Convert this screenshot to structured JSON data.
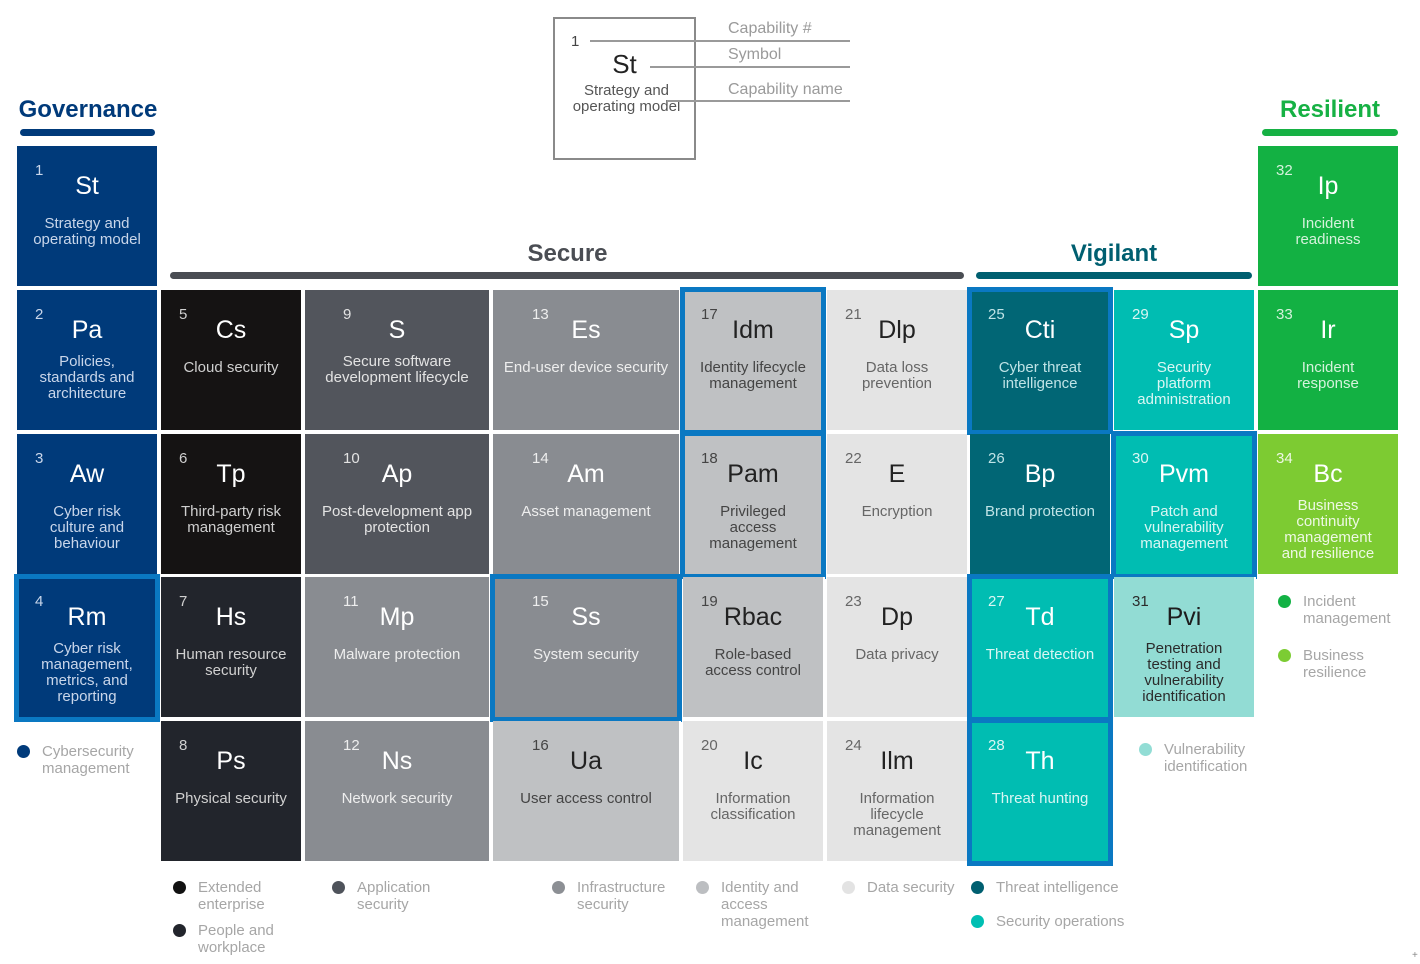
{
  "key": {
    "number": "1",
    "symbol": "St",
    "name": "Strategy and operating model",
    "labels": [
      "Capability #",
      "Symbol",
      "Capability name"
    ]
  },
  "sections": {
    "governance": {
      "title": "Governance",
      "color": "#003a7a"
    },
    "secure": {
      "title": "Secure",
      "color": "#4a4d53"
    },
    "vigilant": {
      "title": "Vigilant",
      "color": "#005f70"
    },
    "resilient": {
      "title": "Resilient",
      "color": "#16b144"
    }
  },
  "capabilities": [
    {
      "num": "1",
      "sym": "St",
      "name": "Strategy and operating model",
      "group": "Cybersecurity management"
    },
    {
      "num": "2",
      "sym": "Pa",
      "name": "Policies, standards and architecture",
      "group": "Cybersecurity management"
    },
    {
      "num": "3",
      "sym": "Aw",
      "name": "Cyber risk culture and behaviour",
      "group": "Cybersecurity management"
    },
    {
      "num": "4",
      "sym": "Rm",
      "name": "Cyber risk management, metrics, and reporting",
      "group": "Cybersecurity management",
      "highlighted": true
    },
    {
      "num": "5",
      "sym": "Cs",
      "name": "Cloud security",
      "group": "Extended enterprise"
    },
    {
      "num": "6",
      "sym": "Tp",
      "name": "Third-party risk management",
      "group": "Extended enterprise"
    },
    {
      "num": "7",
      "sym": "Hs",
      "name": "Human resource security",
      "group": "People and workplace"
    },
    {
      "num": "8",
      "sym": "Ps",
      "name": "Physical security",
      "group": "People and workplace"
    },
    {
      "num": "9",
      "sym": "S",
      "name": "Secure software development lifecycle",
      "group": "Application security"
    },
    {
      "num": "10",
      "sym": "Ap",
      "name": "Post-development app protection",
      "group": "Application security"
    },
    {
      "num": "11",
      "sym": "Mp",
      "name": "Malware protection",
      "group": "Infrastructure security"
    },
    {
      "num": "12",
      "sym": "Ns",
      "name": "Network security",
      "group": "Infrastructure security"
    },
    {
      "num": "13",
      "sym": "Es",
      "name": "End-user device security",
      "group": "Infrastructure security"
    },
    {
      "num": "14",
      "sym": "Am",
      "name": "Asset management",
      "group": "Infrastructure security"
    },
    {
      "num": "15",
      "sym": "Ss",
      "name": "System security",
      "group": "Infrastructure security",
      "highlighted": true
    },
    {
      "num": "16",
      "sym": "Ua",
      "name": "User access control",
      "group": "Identity and access management"
    },
    {
      "num": "17",
      "sym": "Idm",
      "name": "Identity lifecycle management",
      "group": "Identity and access management",
      "highlighted": true
    },
    {
      "num": "18",
      "sym": "Pam",
      "name": "Privileged access management",
      "group": "Identity and access management",
      "highlighted": true
    },
    {
      "num": "19",
      "sym": "Rbac",
      "name": "Role-based access control",
      "group": "Identity and access management"
    },
    {
      "num": "20",
      "sym": "Ic",
      "name": "Information classification",
      "group": "Data security"
    },
    {
      "num": "21",
      "sym": "Dlp",
      "name": "Data loss prevention",
      "group": "Data security"
    },
    {
      "num": "22",
      "sym": "E",
      "name": "Encryption",
      "group": "Data security"
    },
    {
      "num": "23",
      "sym": "Dp",
      "name": "Data privacy",
      "group": "Data security"
    },
    {
      "num": "24",
      "sym": "Ilm",
      "name": "Information lifecycle management",
      "group": "Data security"
    },
    {
      "num": "25",
      "sym": "Cti",
      "name": "Cyber threat intelligence",
      "group": "Threat intelligence",
      "highlighted": true
    },
    {
      "num": "26",
      "sym": "Bp",
      "name": "Brand protection",
      "group": "Threat intelligence"
    },
    {
      "num": "27",
      "sym": "Td",
      "name": "Threat detection",
      "group": "Security operations",
      "highlighted": true
    },
    {
      "num": "28",
      "sym": "Th",
      "name": "Threat hunting",
      "group": "Security operations",
      "highlighted": true
    },
    {
      "num": "29",
      "sym": "Sp",
      "name": "Security platform administration",
      "group": "Security operations"
    },
    {
      "num": "30",
      "sym": "Pvm",
      "name": "Patch and vulnerability management",
      "group": "Security operations",
      "highlighted": true
    },
    {
      "num": "31",
      "sym": "Pvi",
      "name": "Penetration testing and vulnerability identification",
      "group": "Vulnerability identification"
    },
    {
      "num": "32",
      "sym": "Ip",
      "name": "Incident readiness",
      "group": "Incident management"
    },
    {
      "num": "33",
      "sym": "Ir",
      "name": "Incident response",
      "group": "Incident management"
    },
    {
      "num": "34",
      "sym": "Bc",
      "name": "Business continuity management and resilience",
      "group": "Business resilience"
    }
  ],
  "legend": [
    {
      "label": "Cybersecurity management",
      "color": "#003a7a"
    },
    {
      "label": "Extended enterprise",
      "color": "#111111"
    },
    {
      "label": "People and workplace",
      "color": "#22252c"
    },
    {
      "label": "Application security",
      "color": "#4f535b"
    },
    {
      "label": "Infrastructure security",
      "color": "#8c8f94"
    },
    {
      "label": "Identity and access management",
      "color": "#bcbec1"
    },
    {
      "label": "Data security",
      "color": "#e3e3e3"
    },
    {
      "label": "Threat intelligence",
      "color": "#005f70"
    },
    {
      "label": "Security operations",
      "color": "#00bfb3"
    },
    {
      "label": "Vulnerability identification",
      "color": "#92ddd5"
    },
    {
      "label": "Incident management",
      "color": "#12b244"
    },
    {
      "label": "Business resilience",
      "color": "#7ccc33"
    }
  ],
  "highlight_color": "#0a78c2"
}
